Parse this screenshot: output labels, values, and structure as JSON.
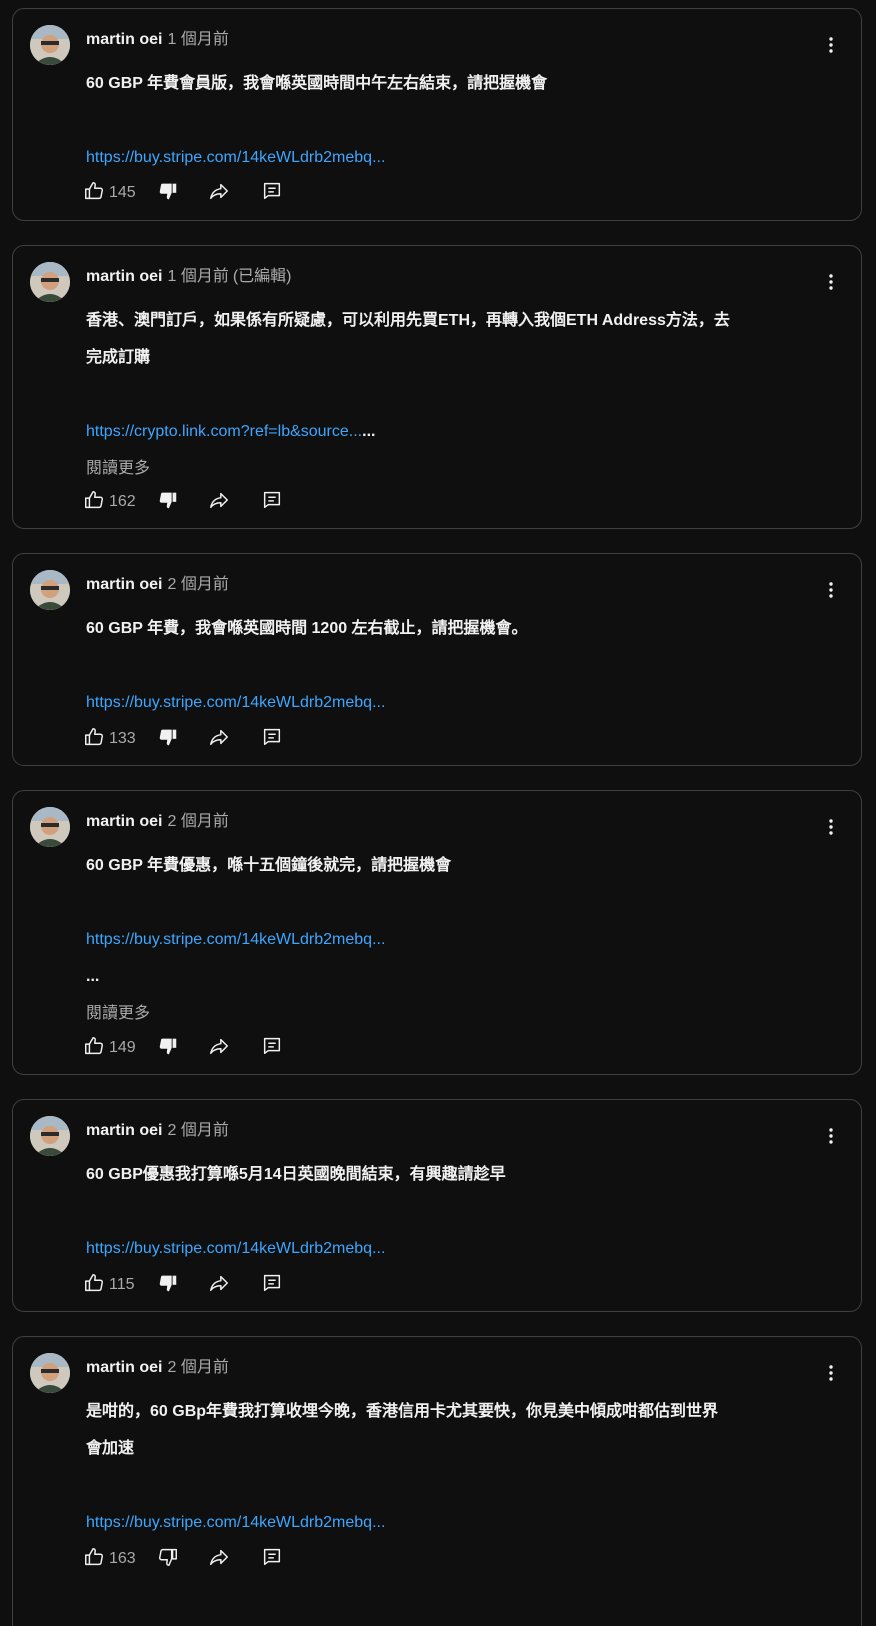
{
  "posts": [
    {
      "author": "martin oei",
      "time": "1 個月前",
      "edited": "",
      "lines": [
        "60 GBP 年費會員版，我會喺英國時間中午左右結束，請把握機會"
      ],
      "link": "https://buy.stripe.com/14keWLdrb2mebq...",
      "link_suffix": "",
      "extra_ellipsis": "",
      "read_more": "",
      "likes": "145"
    },
    {
      "author": "martin oei",
      "time": "1 個月前",
      "edited": "(已編輯)",
      "lines": [
        "香港、澳門訂戶，如果係有所疑慮，可以利用先買ETH，再轉入我個ETH Address方法，去",
        "完成訂購"
      ],
      "link": "https://crypto.link.com?ref=lb&source...",
      "link_suffix": "...",
      "extra_ellipsis": "",
      "read_more": "閱讀更多",
      "likes": "162"
    },
    {
      "author": "martin oei",
      "time": "2 個月前",
      "edited": "",
      "lines": [
        "60 GBP 年費，我會喺英國時間 1200 左右截止，請把握機會。"
      ],
      "link": "https://buy.stripe.com/14keWLdrb2mebq...",
      "link_suffix": "",
      "extra_ellipsis": "",
      "read_more": "",
      "likes": "133"
    },
    {
      "author": "martin oei",
      "time": "2 個月前",
      "edited": "",
      "lines": [
        "60 GBP 年費優惠，喺十五個鐘後就完，請把握機會"
      ],
      "link": "https://buy.stripe.com/14keWLdrb2mebq...",
      "link_suffix": "",
      "extra_ellipsis": "...",
      "read_more": "閱讀更多",
      "likes": "149"
    },
    {
      "author": "martin oei",
      "time": "2 個月前",
      "edited": "",
      "lines": [
        "60 GBP優惠我打算喺5月14日英國晚間結束，有興趣請趁早"
      ],
      "link": "https://buy.stripe.com/14keWLdrb2mebq...",
      "link_suffix": "",
      "extra_ellipsis": "",
      "read_more": "",
      "likes": "115"
    },
    {
      "author": "martin oei",
      "time": "2 個月前",
      "edited": "",
      "lines": [
        "是咁的，60 GBp年費我打算收埋今晚，香港信用卡尤其要快，你見美中傾成咁都估到世界",
        "會加速"
      ],
      "link": "https://buy.stripe.com/14keWLdrb2mebq...",
      "link_suffix": "",
      "extra_ellipsis": "",
      "read_more": "",
      "likes": "163"
    }
  ],
  "icons": {
    "like": "thumbs-up-icon",
    "dislike": "thumbs-down-icon",
    "share": "share-icon",
    "reply": "comment-icon",
    "menu": "more-vertical-icon"
  },
  "colors": {
    "background": "#0f0f0f",
    "border": "#3f3f3f",
    "link": "#3ea6ff",
    "text": "#f1f1f1",
    "muted": "#aaaaaa"
  }
}
